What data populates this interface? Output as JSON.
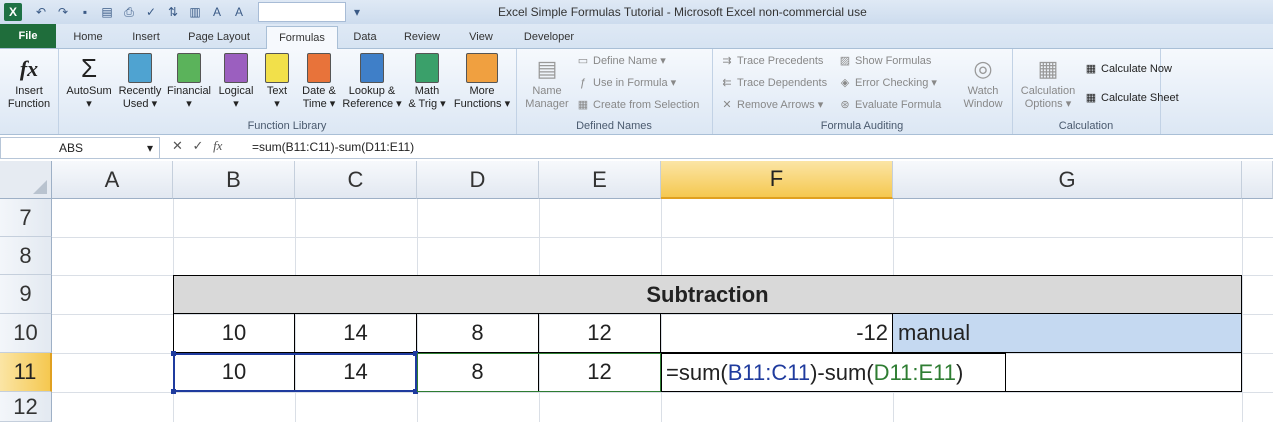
{
  "window": {
    "title": "Excel Simple Formulas Tutorial  -  Microsoft Excel non-commercial use"
  },
  "tabs": [
    "File",
    "Home",
    "Insert",
    "Page Layout",
    "Formulas",
    "Data",
    "Review",
    "View",
    "Developer"
  ],
  "ribbon": {
    "insert_function": {
      "line1": "Insert",
      "line2": "Function"
    },
    "library": {
      "autosum": {
        "line1": "AutoSum",
        "line2": "▾"
      },
      "recently": {
        "line1": "Recently",
        "line2": "Used ▾"
      },
      "financial": {
        "line1": "Financial",
        "line2": "▾"
      },
      "logical": {
        "line1": "Logical",
        "line2": "▾"
      },
      "text": {
        "line1": "Text",
        "line2": "▾"
      },
      "datetime": {
        "line1": "Date &",
        "line2": "Time ▾"
      },
      "lookup": {
        "line1": "Lookup &",
        "line2": "Reference ▾"
      },
      "math": {
        "line1": "Math",
        "line2": "& Trig ▾"
      },
      "more": {
        "line1": "More",
        "line2": "Functions ▾"
      }
    },
    "function_library_label": "Function Library",
    "defined_names": {
      "name_manager": {
        "line1": "Name",
        "line2": "Manager"
      },
      "define_name": "Define Name ▾",
      "use_in_formula": "Use in Formula ▾",
      "create_from_selection": "Create from Selection",
      "label": "Defined Names"
    },
    "auditing": {
      "trace_precedents": "Trace Precedents",
      "trace_dependents": "Trace Dependents",
      "remove_arrows": "Remove Arrows ▾",
      "show_formulas": "Show Formulas",
      "error_checking": "Error Checking ▾",
      "evaluate_formula": "Evaluate Formula",
      "watch_window": {
        "line1": "Watch",
        "line2": "Window"
      },
      "label": "Formula Auditing"
    },
    "calculation": {
      "options": {
        "line1": "Calculation",
        "line2": "Options ▾"
      },
      "calculate_now": "Calculate Now",
      "calculate_sheet": "Calculate Sheet",
      "label": "Calculation"
    }
  },
  "formula_bar": {
    "name_box": "ABS",
    "formula": "=sum(B11:C11)-sum(D11:E11)"
  },
  "columns": [
    "A",
    "B",
    "C",
    "D",
    "E",
    "F",
    "G"
  ],
  "rows": [
    "7",
    "8",
    "9",
    "10",
    "11",
    "12"
  ],
  "cells": {
    "title": "Subtraction",
    "r10": {
      "b": "10",
      "c": "14",
      "d": "8",
      "e": "12",
      "f": "-12",
      "g": "manual"
    },
    "r11": {
      "b": "10",
      "c": "14",
      "d": "8",
      "e": "12"
    },
    "edit_formula": {
      "p1": "=sum(",
      "p2": "B11:C11",
      "p3": ")-sum(",
      "p4": "D11:E11",
      "p5": ")"
    }
  },
  "colors": {
    "ref_blue": "#1f3b9e",
    "ref_green": "#2e7d32",
    "title_fill": "#d9d9d9",
    "manual_fill": "#c5d9f1",
    "file_tab": "#1f6d3b"
  }
}
